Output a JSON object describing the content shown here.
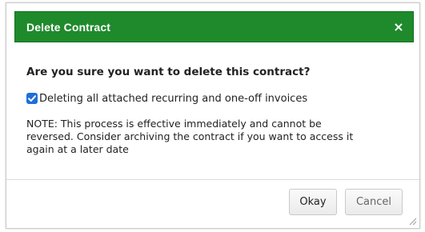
{
  "dialog": {
    "title": "Delete Contract",
    "close_label": "×",
    "question": "Are you sure you want to delete this contract?",
    "checkbox": {
      "label": "Deleting all attached recurring and one-off invoices",
      "checked": true
    },
    "note_lines": [
      "NOTE: This process is effective immediately and cannot be",
      "reversed. Consider archiving the contract if you want to access it",
      "again at a later date"
    ],
    "buttons": {
      "okay_label": "Okay",
      "cancel_label": "Cancel"
    },
    "resize_icon": "resize-grip-icon"
  },
  "colors": {
    "titlebar": "#1f8a2c",
    "checkbox": "#1e6fd9"
  }
}
